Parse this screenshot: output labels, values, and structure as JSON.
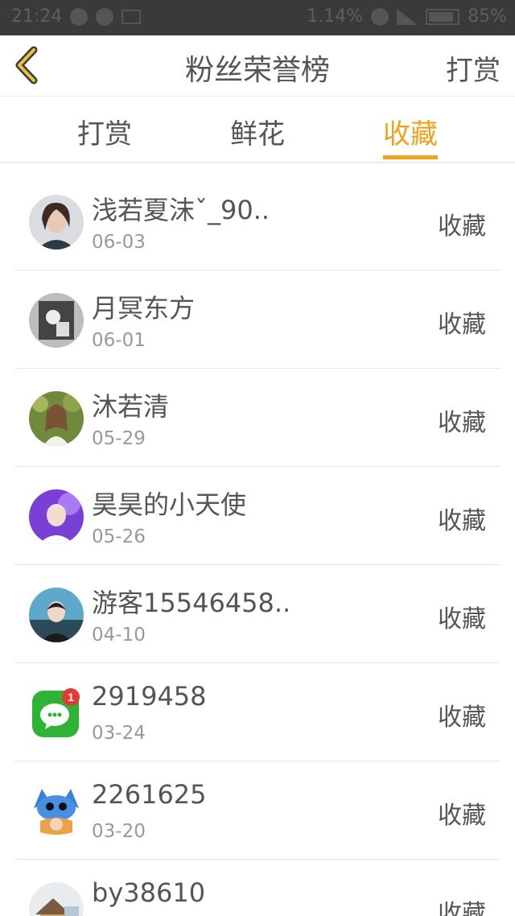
{
  "status_bar": {
    "time": "21:24",
    "battery": "1.14%",
    "network": "85%"
  },
  "nav": {
    "title": "粉丝荣誉榜",
    "right_label": "打赏"
  },
  "tabs": [
    {
      "label": "打赏",
      "active": false
    },
    {
      "label": "鲜花",
      "active": false
    },
    {
      "label": "收藏",
      "active": true
    }
  ],
  "colors": {
    "accent": "#f0a11d",
    "text": "#555555",
    "subtext": "#999999"
  },
  "list": [
    {
      "name": "浅若夏沫ˇ_90..",
      "date": "06-03",
      "action": "收藏",
      "avatar": "woman-photo"
    },
    {
      "name": "月冥东方",
      "date": "06-01",
      "action": "收藏",
      "avatar": "bw-photo"
    },
    {
      "name": "沐若清",
      "date": "05-29",
      "action": "收藏",
      "avatar": "garden-photo"
    },
    {
      "name": "昊昊的小天使",
      "date": "05-26",
      "action": "收藏",
      "avatar": "purple-photo"
    },
    {
      "name": "游客15546458..",
      "date": "04-10",
      "action": "收藏",
      "avatar": "boy-photo"
    },
    {
      "name": "2919458",
      "date": "03-24",
      "action": "收藏",
      "avatar": "wechat-icon"
    },
    {
      "name": "2261625",
      "date": "03-20",
      "action": "收藏",
      "avatar": "cartoon-icon"
    },
    {
      "name": "by38610",
      "date": "",
      "action": "收藏",
      "avatar": "house-photo"
    }
  ]
}
